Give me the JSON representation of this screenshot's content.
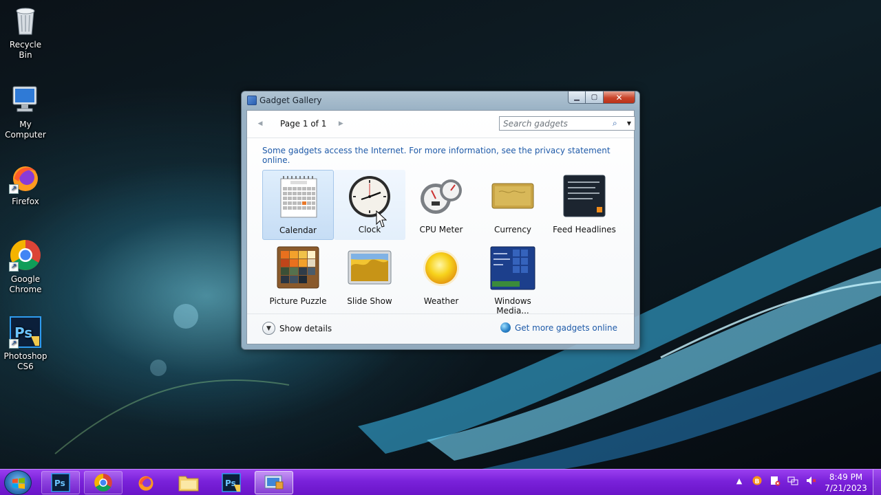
{
  "desktop": {
    "icons": [
      {
        "label": "Recycle Bin",
        "icon": "recycle-bin-icon"
      },
      {
        "label": "My\nComputer",
        "icon": "my-computer-icon"
      },
      {
        "label": "Firefox",
        "icon": "firefox-icon"
      },
      {
        "label": "Google\nChrome",
        "icon": "chrome-icon"
      },
      {
        "label": "Photoshop\nCS6",
        "icon": "photoshop-icon"
      }
    ]
  },
  "window": {
    "title": "Gadget Gallery",
    "controls": {
      "minimize": "minimize-icon",
      "maximize": "maximize-icon",
      "close": "close-icon"
    },
    "pager": {
      "text": "Page 1 of 1"
    },
    "search": {
      "placeholder": "Search gadgets"
    },
    "notice": "Some gadgets access the Internet.  For more information, see the privacy statement online.",
    "gadgets": [
      {
        "label": "Calendar",
        "state": "selected"
      },
      {
        "label": "Clock",
        "state": "hover"
      },
      {
        "label": "CPU Meter",
        "state": "normal"
      },
      {
        "label": "Currency",
        "state": "normal"
      },
      {
        "label": "Feed Headlines",
        "state": "normal"
      },
      {
        "label": "Picture Puzzle",
        "state": "normal"
      },
      {
        "label": "Slide Show",
        "state": "normal"
      },
      {
        "label": "Weather",
        "state": "normal"
      },
      {
        "label": "Windows Media...",
        "state": "normal"
      }
    ],
    "footer": {
      "show_details": "Show details",
      "more_link": "Get more gadgets online"
    }
  },
  "taskbar": {
    "buttons": [
      "photoshop",
      "chrome",
      "firefox",
      "explorer",
      "photoshop-cs6",
      "gadget-gallery"
    ],
    "active": "gadget-gallery",
    "clock": {
      "time": "8:49 PM",
      "date": "7/21/2023"
    }
  },
  "colors": {
    "taskbar": "#7a22da",
    "link": "#1e5aa8",
    "selection": "#c6ddf5"
  }
}
